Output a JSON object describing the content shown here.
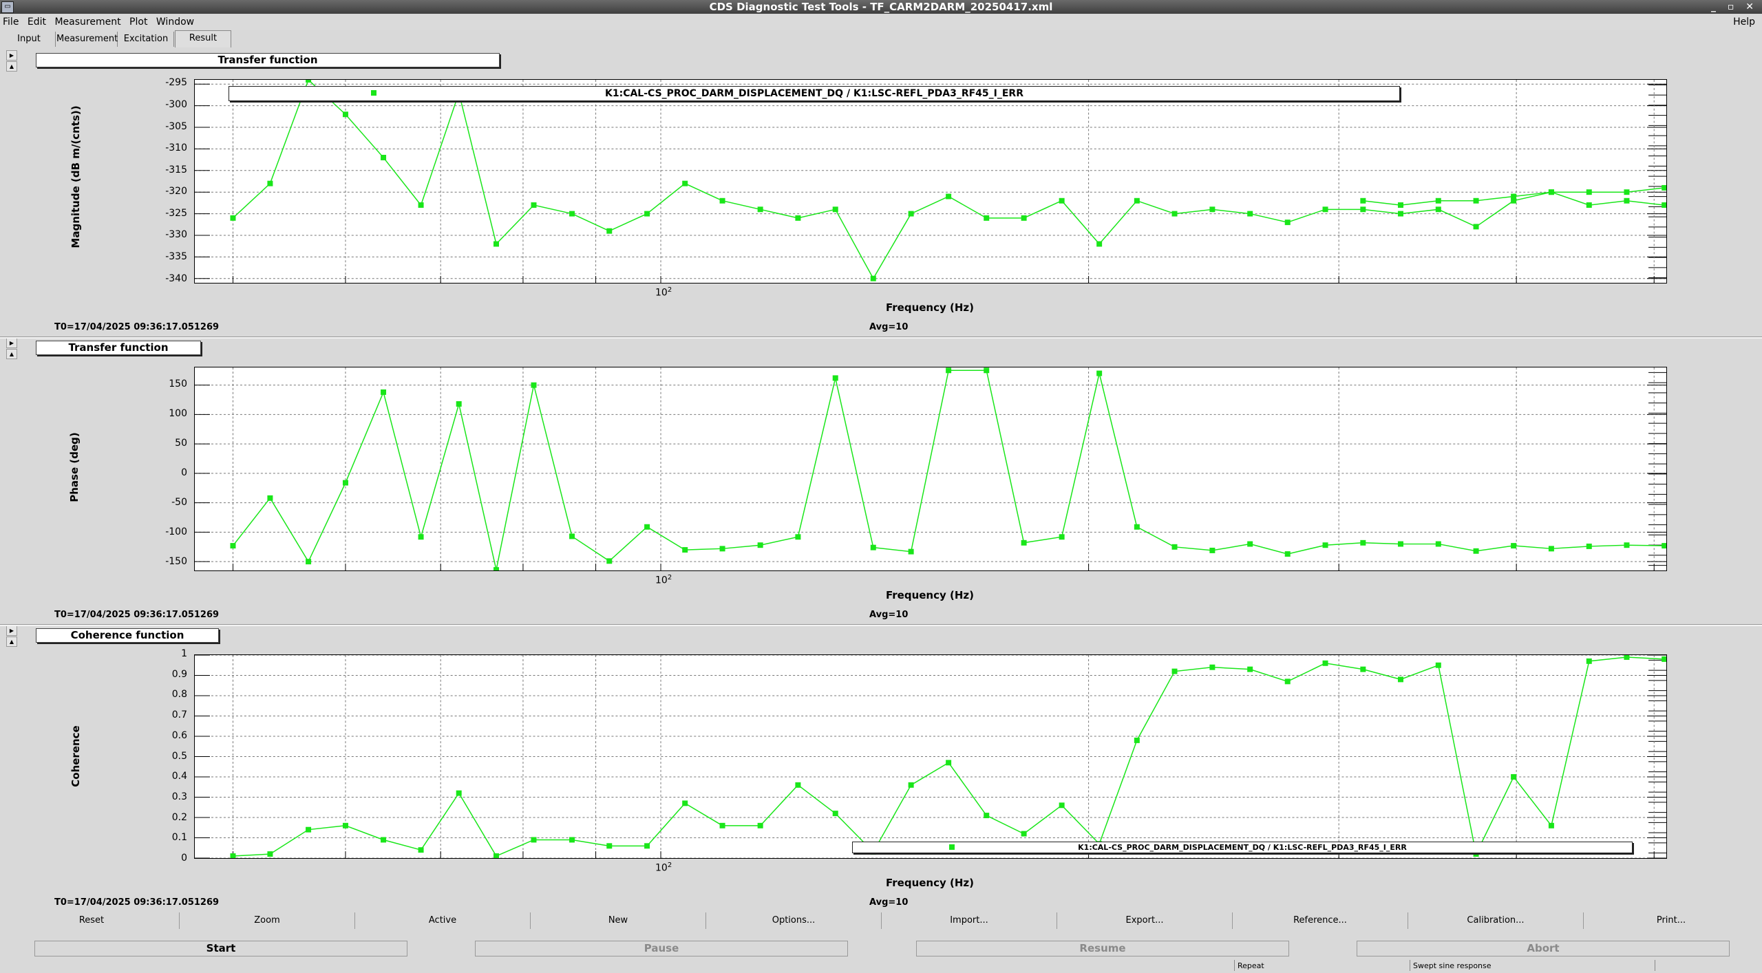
{
  "window": {
    "title": "CDS Diagnostic Test Tools - TF_CARM2DARM_20250417.xml",
    "controls": "_ ▫ ✕"
  },
  "menu": {
    "file": "File",
    "edit": "Edit",
    "measurement": "Measurement",
    "plot": "Plot",
    "window": "Window",
    "help": "Help"
  },
  "tabs": [
    "Input",
    "Measurement",
    "Excitation",
    "Result"
  ],
  "active_tab": "Result",
  "panels": [
    {
      "title": "Transfer function",
      "ylabel": "Magnitude (dB m/(cnts))",
      "xlabel": "Frequency (Hz)",
      "t0": "T0=17/04/2025 09:36:17.051269",
      "avg": "Avg=10",
      "xtick": "10",
      "xtick_exp": "2",
      "yticks": [
        "-295",
        "-300",
        "-305",
        "-310",
        "-315",
        "-320",
        "-325",
        "-330",
        "-335",
        "-340"
      ],
      "legend": "K1:CAL-CS_PROC_DARM_DISPLACEMENT_DQ / K1:LSC-REFL_PDA3_RF45_I_ERR"
    },
    {
      "title": "Transfer function",
      "ylabel": "Phase (deg)",
      "xlabel": "Frequency (Hz)",
      "t0": "T0=17/04/2025 09:36:17.051269",
      "avg": "Avg=10",
      "xtick": "10",
      "xtick_exp": "2",
      "yticks": [
        "150",
        "100",
        "50",
        "0",
        "-50",
        "-100",
        "-150"
      ]
    },
    {
      "title": "Coherence function",
      "ylabel": "Coherence",
      "xlabel": "Frequency (Hz)",
      "t0": "T0=17/04/2025 09:36:17.051269",
      "avg": "Avg=10",
      "xtick": "10",
      "xtick_exp": "2",
      "yticks": [
        "1",
        "0.9",
        "0.8",
        "0.7",
        "0.6",
        "0.5",
        "0.4",
        "0.3",
        "0.2",
        "0.1",
        "0"
      ],
      "legend": "K1:CAL-CS_PROC_DARM_DISPLACEMENT_DQ / K1:LSC-REFL_PDA3_RF45_I_ERR"
    }
  ],
  "buttons": [
    "Reset",
    "Zoom",
    "Active",
    "New",
    "Options...",
    "Import...",
    "Export...",
    "Reference...",
    "Calibration...",
    "Print..."
  ],
  "controls": {
    "start": "Start",
    "pause": "Pause",
    "resume": "Resume",
    "abort": "Abort"
  },
  "status": {
    "repeat": "Repeat",
    "mode": "Swept sine response"
  },
  "series_color": "#19e619",
  "chart_data": [
    {
      "type": "line",
      "log_x": true,
      "xlim": [
        47,
        510
      ],
      "ylim": [
        -341,
        -294
      ],
      "x": [
        50,
        53.1,
        56.5,
        60,
        63.8,
        67.8,
        72.1,
        76.6,
        81.4,
        86.6,
        92,
        97.8,
        104,
        110.5,
        117.5,
        124.9,
        132.7,
        141.1,
        150,
        159.4,
        169.5,
        180.1,
        191.5,
        203.5,
        216.3,
        229.9,
        244.4,
        259.8,
        276.1,
        293.5,
        312,
        331.6,
        352.5,
        374.7,
        398.2,
        423.3,
        450,
        478.3,
        508.4
      ],
      "y": [
        -326,
        -318,
        -294,
        -302,
        -312,
        -323,
        -297,
        -332,
        -323,
        -325,
        -329,
        -325,
        -318,
        -322,
        -324,
        -326,
        -324,
        -340,
        -325,
        -321,
        -326,
        -326,
        -322,
        -332,
        -322,
        -325,
        -324,
        -325,
        -327,
        -324,
        -324,
        -325,
        -324,
        -328,
        -322,
        -320,
        -323,
        -322,
        -323
      ],
      "x2": [
        312,
        331.6,
        352.5,
        374.7,
        398.2,
        423.3,
        450,
        478.3,
        508.4
      ],
      "y2": [
        -322,
        -323,
        -322,
        -322,
        -321,
        -320,
        -320,
        -320,
        -319
      ]
    },
    {
      "type": "line",
      "log_x": true,
      "ylim": [
        -165,
        180
      ],
      "y": [
        -123,
        -42,
        -150,
        -16,
        138,
        -108,
        118,
        -164,
        150,
        -107,
        -149,
        -91,
        -130,
        -128,
        -122,
        -108,
        162,
        -126,
        -133,
        175,
        175,
        -118,
        -108,
        170,
        -91,
        -125,
        -131,
        -120,
        -137,
        -122,
        -118,
        -120,
        -120,
        -132,
        -123,
        -128,
        -124,
        -122,
        -123
      ]
    },
    {
      "type": "line",
      "log_x": true,
      "ylim": [
        0,
        1.0
      ],
      "y": [
        0.01,
        0.02,
        0.14,
        0.16,
        0.09,
        0.04,
        0.32,
        0.01,
        0.09,
        0.09,
        0.06,
        0.06,
        0.27,
        0.16,
        0.16,
        0.36,
        0.22,
        0.03,
        0.36,
        0.47,
        0.21,
        0.12,
        0.26,
        0.07,
        0.58,
        0.92,
        0.94,
        0.93,
        0.87,
        0.96,
        0.93,
        0.88,
        0.95,
        0.02,
        0.4,
        0.16,
        0.97,
        0.99,
        0.98
      ]
    }
  ]
}
